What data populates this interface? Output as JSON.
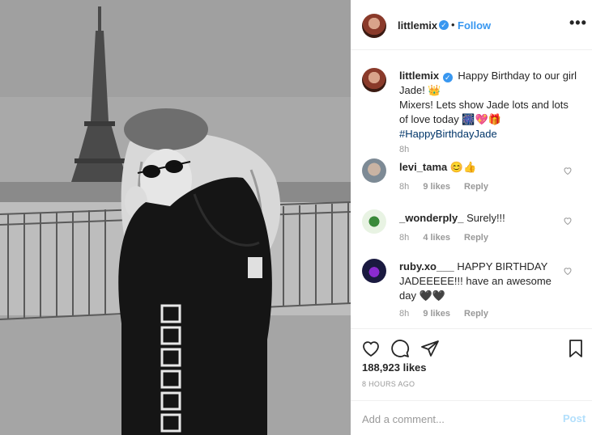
{
  "post": {
    "username": "littlemix",
    "follow_label": "Follow",
    "separator": "•",
    "more_label": "•••"
  },
  "caption": {
    "username": "littlemix",
    "line1": "Happy Birthday to our girl Jade! 👑",
    "line2": "Mixers! Lets show Jade lots and lots of love today 🎆💖🎁",
    "hashtag": "#HappyBirthdayJade",
    "time": "8h"
  },
  "comments": [
    {
      "username": "levi_tama",
      "text": "😊👍",
      "time": "8h",
      "likes": "9 likes",
      "reply": "Reply"
    },
    {
      "username": "_wonderply_",
      "text": "Surely!!!",
      "time": "8h",
      "likes": "4 likes",
      "reply": "Reply"
    },
    {
      "username": "ruby.xo___",
      "text": "HAPPY BIRTHDAY JADEEEEE!!! have an awesome day 🖤🖤",
      "time": "8h",
      "likes": "9 likes",
      "reply": "Reply"
    }
  ],
  "actions": {
    "likes": "188,923 likes",
    "ago": "8 HOURS AGO"
  },
  "add_comment": {
    "placeholder": "Add a comment...",
    "post_label": "Post"
  },
  "colors": {
    "link": "#3897f0",
    "hashtag": "#003569",
    "post_disabled": "#b2dffc"
  }
}
